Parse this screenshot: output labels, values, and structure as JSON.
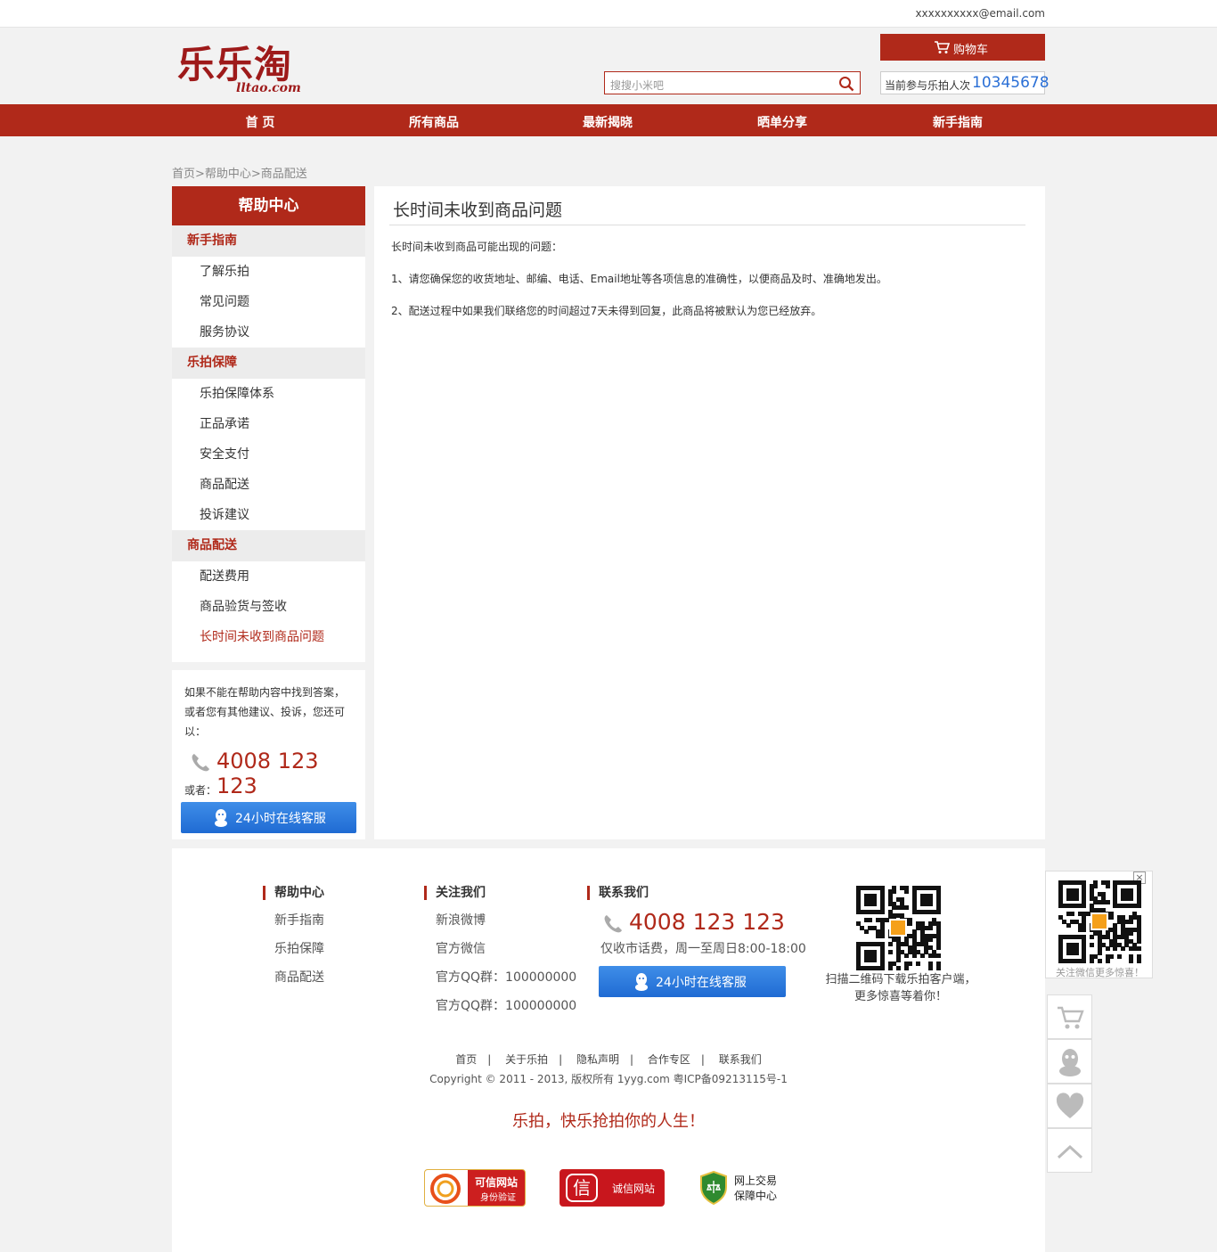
{
  "topbar": {
    "email": "xxxxxxxxxx@email.com"
  },
  "header": {
    "logo_text": "乐乐淘",
    "logo_domain": "lltao.com",
    "search_placeholder": "搜搜小米吧",
    "cart_label": "购物车",
    "counter_label": "当前参与乐拍人次",
    "counter_value": "10345678"
  },
  "nav": [
    "首 页",
    "所有商品",
    "最新揭晓",
    "晒单分享",
    "新手指南"
  ],
  "breadcrumb": "首页>帮助中心>商品配送",
  "sidebar": {
    "title": "帮助中心",
    "groups": [
      {
        "title": "新手指南",
        "links": [
          "了解乐拍",
          "常见问题",
          "服务协议"
        ]
      },
      {
        "title": "乐拍保障",
        "links": [
          "乐拍保障体系",
          "正品承诺",
          "安全支付",
          "商品配送",
          "投诉建议"
        ]
      },
      {
        "title": "商品配送",
        "links": [
          "配送费用",
          "商品验货与签收",
          "长时间未收到商品问题"
        ]
      }
    ],
    "active_link": "长时间未收到商品问题"
  },
  "contact": {
    "text": "如果不能在帮助内容中找到答案，或者您有其他建议、投诉，您还可以：",
    "phone": "4008 123 123",
    "or": "或者：",
    "service_button": "24小时在线客服"
  },
  "article": {
    "title": "长时间未收到商品问题",
    "paragraphs": [
      "长时间未收到商品可能出现的问题：",
      "1、请您确保您的收货地址、邮编、电话、Email地址等各项信息的准确性，以便商品及时、准确地发出。",
      "2、配送过程中如果我们联络您的时间超过7天未得到回复，此商品将被默认为您已经放弃。"
    ]
  },
  "footer": {
    "help": {
      "title": "帮助中心",
      "links": [
        "新手指南",
        "乐拍保障",
        "商品配送"
      ]
    },
    "follow": {
      "title": "关注我们",
      "links": [
        "新浪微博",
        "官方微信",
        "官方QQ群：100000000",
        "官方QQ群：100000000"
      ]
    },
    "contact": {
      "title": "联系我们",
      "phone": "4008 123 123",
      "hours": "仅收市话费，周一至周日8:00-18:00",
      "service_button": "24小时在线客服"
    },
    "scan_text": "扫描二维码下载乐拍客户端，更多惊喜等着你！",
    "links": [
      "首页",
      "关于乐拍",
      "隐私声明",
      "合作专区",
      "联系我们"
    ],
    "copyright": "Copyright © 2011 - 2013, 版权所有 1yyg.com 粤ICP备09213115号-1",
    "slogan": "乐拍，快乐抢拍你的人生！",
    "badges": {
      "b1_line1": "可信网站",
      "b1_line2": "身份验证",
      "b2_icon": "信",
      "b2_text": "诚信网站",
      "b3_line1": "网上交易",
      "b3_line2": "保障中心"
    }
  },
  "float": {
    "qr_caption": "关注微信更多惊喜！",
    "close": "×"
  },
  "colors": {
    "brand": "#b0291a",
    "link_blue": "#2a6fd6"
  }
}
